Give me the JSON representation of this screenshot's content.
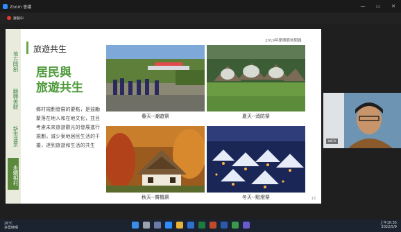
{
  "window": {
    "title": "Zoom 會議",
    "minimize": "—",
    "maximize": "▭",
    "close": "✕"
  },
  "share_bar": {
    "label": "錄製中"
  },
  "slide": {
    "side_tabs": [
      "地方開創",
      "翻轉美觀",
      "新市遠景",
      "永續相村"
    ],
    "active_tab_index": 3,
    "title": "旅遊共生",
    "year_label": "2019年摩擦節地問題",
    "heading_line1": "居民與",
    "heading_line2": "旅遊共生",
    "body_text": "鄉村規劃發展的要點，是鼓勵聚落在地人和在地文化，並且考慮未來旅遊觀光的發展進行規劃，減少案地居民生活的干擾，達到旅遊和生活的共生",
    "photos": [
      {
        "caption": "春天--潮遊祭"
      },
      {
        "caption": "夏天--消防祭"
      },
      {
        "caption": "秋天--賞楓祭"
      },
      {
        "caption": "冬天--點燈祭"
      }
    ],
    "page_number": "13"
  },
  "video": {
    "name": "ed.h"
  },
  "taskbar": {
    "weather_temp": "26°C",
    "weather_desc": "多雲時晴",
    "time": "上午10:35",
    "date": "2022/5/9"
  }
}
